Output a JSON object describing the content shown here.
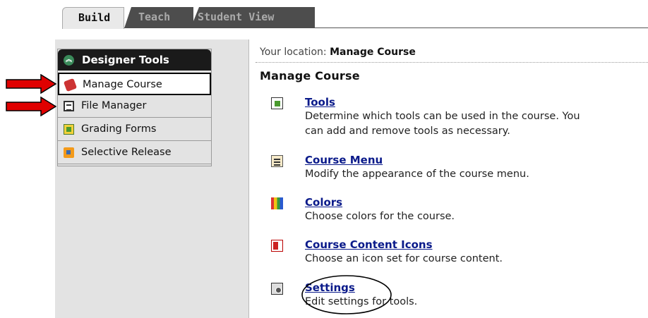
{
  "tabs": [
    {
      "label": "Build",
      "active": true
    },
    {
      "label": "Teach",
      "active": false
    },
    {
      "label": "Student View",
      "active": false
    }
  ],
  "sidebar": {
    "header": "Designer Tools",
    "header_icon": "chevron-up-icon",
    "items": [
      {
        "label": "Manage Course",
        "icon": "toolbox-icon",
        "active": true
      },
      {
        "label": "File Manager",
        "icon": "file-manager-icon",
        "active": false
      },
      {
        "label": "Grading Forms",
        "icon": "grading-forms-icon",
        "active": false
      },
      {
        "label": "Selective Release",
        "icon": "selective-release-icon",
        "active": false
      }
    ]
  },
  "location": {
    "prefix": "Your location:",
    "current": "Manage Course"
  },
  "page_title": "Manage Course",
  "tools": [
    {
      "title": "Tools",
      "icon": "tools-icon",
      "description": [
        "Determine which tools can be used in the course. You",
        "can add and remove tools as necessary."
      ]
    },
    {
      "title": "Course Menu",
      "icon": "course-menu-icon",
      "description": [
        "Modify the appearance of the course menu."
      ]
    },
    {
      "title": "Colors",
      "icon": "colors-icon",
      "description": [
        "Choose colors for the course."
      ]
    },
    {
      "title": "Course Content Icons",
      "icon": "course-content-icons-icon",
      "description": [
        "Choose an icon set for course content."
      ]
    },
    {
      "title": "Settings",
      "icon": "settings-icon",
      "description": [
        "Edit settings for tools."
      ]
    }
  ],
  "annotations": {
    "arrow_color": "#e00000",
    "arrows_point_to": [
      "Manage Course",
      "File Manager"
    ],
    "circled_item": "Settings"
  },
  "colors": {
    "link": "#0a1a8a",
    "panel_bg": "#e3e3e3",
    "header_bg": "#1a1a1a",
    "tab_inactive_bg": "#4d4d4d"
  }
}
